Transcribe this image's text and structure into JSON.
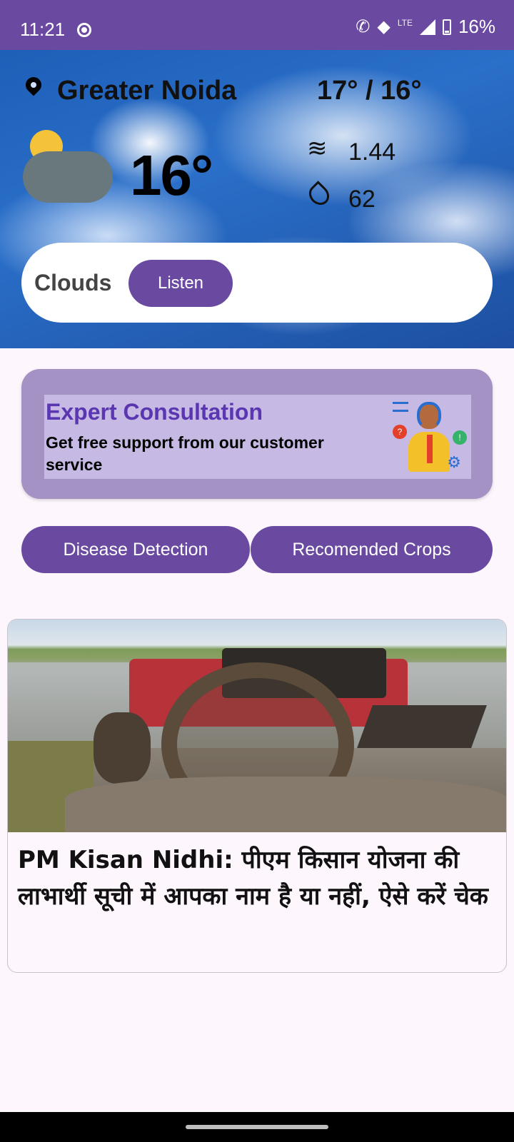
{
  "status_bar": {
    "time": "11:21",
    "network": "LTE",
    "battery": "16%"
  },
  "weather": {
    "location": "Greater Noida",
    "hi_lo": "17° / 16°",
    "temperature": "16°",
    "condition_icon": "partly-cloudy-night-icon",
    "wind": "1.44",
    "humidity": "62",
    "condition": "Clouds",
    "listen_label": "Listen"
  },
  "expert": {
    "title": "Expert Consultation",
    "subtitle": "Get free support from our customer service"
  },
  "actions": {
    "disease_label": "Disease Detection",
    "crops_label": "Recomended Crops"
  },
  "news": {
    "headline": "PM Kisan Nidhi: पीएम किसान योजना की लाभार्थी सूची में आपका नाम है या नहीं, ऐसे करें चेक"
  },
  "colors": {
    "primary": "#6a4aa0",
    "expert_bg": "#a492c4",
    "expert_banner": "#c6b9e4",
    "expert_title": "#5a36b0"
  }
}
